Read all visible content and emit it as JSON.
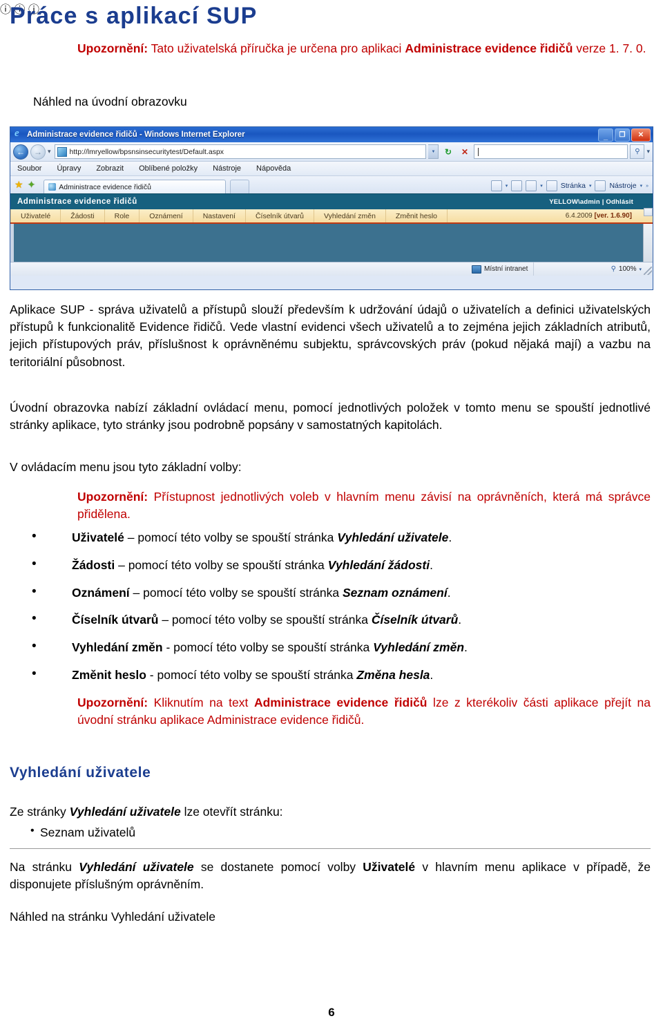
{
  "document": {
    "title": "Práce s aplikací SUP",
    "page_number": "6",
    "title_color": "#1b3d8f",
    "warning_color": "#c00000",
    "heading_color": "#1b3d8f"
  },
  "warning_top": {
    "icon": "warning-pointer-icon",
    "label": "Upozornění:",
    "text_1": " Tato uživatelská příručka je určena pro aplikaci ",
    "bold_1": "Administrace evidence řidičů",
    "text_2": " verze 1. 7. 0."
  },
  "caption_screenshot": "Náhled na úvodní obrazovku",
  "screenshot": {
    "titlebar": {
      "text": "Administrace evidence řidičů - Windows Internet Explorer",
      "icon": "internet-explorer-icon",
      "minimize": "_",
      "maximize": "❐",
      "close": "✕"
    },
    "address_bar": {
      "back_arrow": "←",
      "forward_arrow": "→",
      "history_caret": "▾",
      "url": "http://lmryellow/bpsnsinsecuritytest/Default.aspx",
      "refresh": "↻",
      "stop": "✕",
      "search_value": "",
      "search_icon": "magnifier-icon"
    },
    "ie_menu": [
      "Soubor",
      "Úpravy",
      "Zobrazit",
      "Oblíbené položky",
      "Nástroje",
      "Nápověda"
    ],
    "tabbar": {
      "favorites_icon": "star-icon",
      "add-favorites_icon": "add-favorites-icon",
      "tab_label": "Administrace evidence řidičů",
      "tools": [
        {
          "label": "",
          "icon": "home-icon"
        },
        {
          "label": "",
          "icon": "feeds-icon"
        },
        {
          "label": "",
          "icon": "print-icon"
        },
        {
          "label": "Stránka",
          "icon": "page-icon"
        },
        {
          "label": "Nástroje",
          "icon": "tools-icon"
        }
      ],
      "overflow": "»"
    },
    "app": {
      "header_title": "Administrace evidence řidičů",
      "user": "YELLOW\\admin  |  Odhlásit",
      "menu_items": [
        "Uživatelé",
        "Žádosti",
        "Role",
        "Oznámení",
        "Nastavení",
        "Číselník útvarů",
        "Vyhledání změn",
        "Změnit heslo"
      ],
      "version_date": "6.4.2009 ",
      "version_tag": "[ver. 1.6.90]",
      "header_bg": "#17607f",
      "menu_bg": "#f6dda2",
      "menu_underline": "#c13a12",
      "body_bg": "#3c718f"
    },
    "statusbar": {
      "zone_icon": "intranet-monitor-icon",
      "zone": "Místní intranet",
      "zoom_icon": "magnifier-icon",
      "zoom": "100%",
      "zoom_caret": "▾"
    }
  },
  "body": {
    "p1_part1": "Aplikace SUP - správa uživatelů a přístupů slouží především k udržování údajů o uživatelích a definici uživatelských přístupů k funkcionalitě Evidence řidičů. Vede vlastní evidenci všech uživatelů a to zejména jejich základních atributů, jejich přístupových práv, příslušnost k oprávněnému subjektu, správcovských práv (pokud nějaká mají) a vazbu na teritoriální působnost.",
    "p2": "Úvodní obrazovka nabízí základní ovládací menu, pomocí jednotlivých položek v tomto menu se spouští jednotlivé stránky aplikace, tyto stránky jsou podrobně popsány v samostatných kapitolách.",
    "p3": "V ovládacím menu jsou tyto základní volby:"
  },
  "warning_middle": {
    "icon": "warning-pointer-icon",
    "label": "Upozornění:",
    "text": " Přístupnost jednotlivých voleb v hlavním menu závisí na oprávněních, která má správce přidělena."
  },
  "menu_bullets": [
    {
      "term": "Uživatelé",
      "middle": " – pomocí této volby se spouští stránka ",
      "page": "Vyhledání uživatele",
      "end": "."
    },
    {
      "term": "Žádosti",
      "middle": " – pomocí této volby se spouští stránka ",
      "page": "Vyhledání žádosti",
      "end": "."
    },
    {
      "term": "Oznámení",
      "middle": " – pomocí této volby se spouští stránka ",
      "page": "Seznam oznámení",
      "end": "."
    },
    {
      "term": "Číselník útvarů",
      "middle": " – pomocí této volby se spouští stránka ",
      "page": "Číselník útvarů",
      "end": "."
    },
    {
      "term": "Vyhledání změn",
      "middle": " - pomocí této volby se spouští stránka ",
      "page": "Vyhledání změn",
      "end": "."
    },
    {
      "term": "Změnit heslo",
      "middle": " - pomocí této volby se spouští stránka ",
      "page": "Změna hesla",
      "end": "."
    }
  ],
  "warning_bottom": {
    "icon": "warning-pointer-icon",
    "label": "Upozornění:",
    "text_1": " Kliknutím na text ",
    "bold_1": "Administrace evidence řidičů",
    "text_2": " lze z kterékoliv části aplikace přejít na úvodní stránku aplikace Administrace evidence řidičů."
  },
  "section": {
    "heading": "Vyhledání uživatele",
    "intro_prefix": "Ze stránky ",
    "intro_italic": "Vyhledání uživatele",
    "intro_suffix": " lze otevřít stránku:",
    "sub_items": [
      "Seznam uživatelů"
    ]
  },
  "footer_block": {
    "p_prefix": "Na stránku ",
    "p_italic": "Vyhledání uživatele",
    "p_middle": " se dostanete pomocí volby ",
    "p_bold": "Uživatelé",
    "p_suffix": " v hlavním menu aplikace v případě, že disponujete příslušným oprávněním.",
    "caption": "Náhled na stránku Vyhledání uživatele"
  }
}
